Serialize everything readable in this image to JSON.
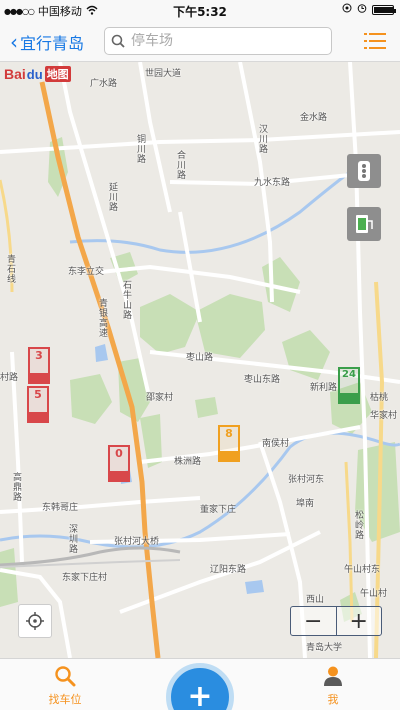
{
  "status_bar": {
    "carrier": "中国移动",
    "time": "下午5:32"
  },
  "nav": {
    "back_label": "宜行青岛",
    "search_placeholder": "停车场",
    "menu_icon": "list-icon"
  },
  "map": {
    "logo": {
      "brand": "Bai",
      "paw": "du",
      "cn": "地图"
    },
    "road_labels": [
      "广水路",
      "世园大道",
      "金水路",
      "铜川路",
      "合川路",
      "汉川路",
      "九水东路",
      "延川路",
      "青石线",
      "东李立交",
      "青银高速",
      "石牛山路",
      "枣山路",
      "枣山东路",
      "新利路",
      "邵家村",
      "株洲路",
      "南侯村",
      "张村河东",
      "埠南",
      "董家下庄",
      "东韩哥庄",
      "高鼎路",
      "深圳路",
      "东家下庄村",
      "张村河大桥",
      "辽阳东路",
      "西山",
      "午山村",
      "青岛大学",
      "松岭路",
      "枯桃",
      "华家村",
      "村路",
      "午山村东"
    ],
    "markers": [
      {
        "count": "3",
        "color": "#d8474a"
      },
      {
        "count": "5",
        "color": "#d8474a"
      },
      {
        "count": "0",
        "color": "#d8474a"
      },
      {
        "count": "8",
        "color": "#f0a020"
      },
      {
        "count": "24",
        "color": "#3a9e4a"
      }
    ],
    "zoom": {
      "minus": "−",
      "plus": "+"
    }
  },
  "tabs": {
    "find_parking": "找车位",
    "add": "+",
    "me": "我"
  },
  "colors": {
    "accent_orange": "#f5921e",
    "accent_blue": "#1778e4",
    "fab_blue": "#2a8de0"
  }
}
